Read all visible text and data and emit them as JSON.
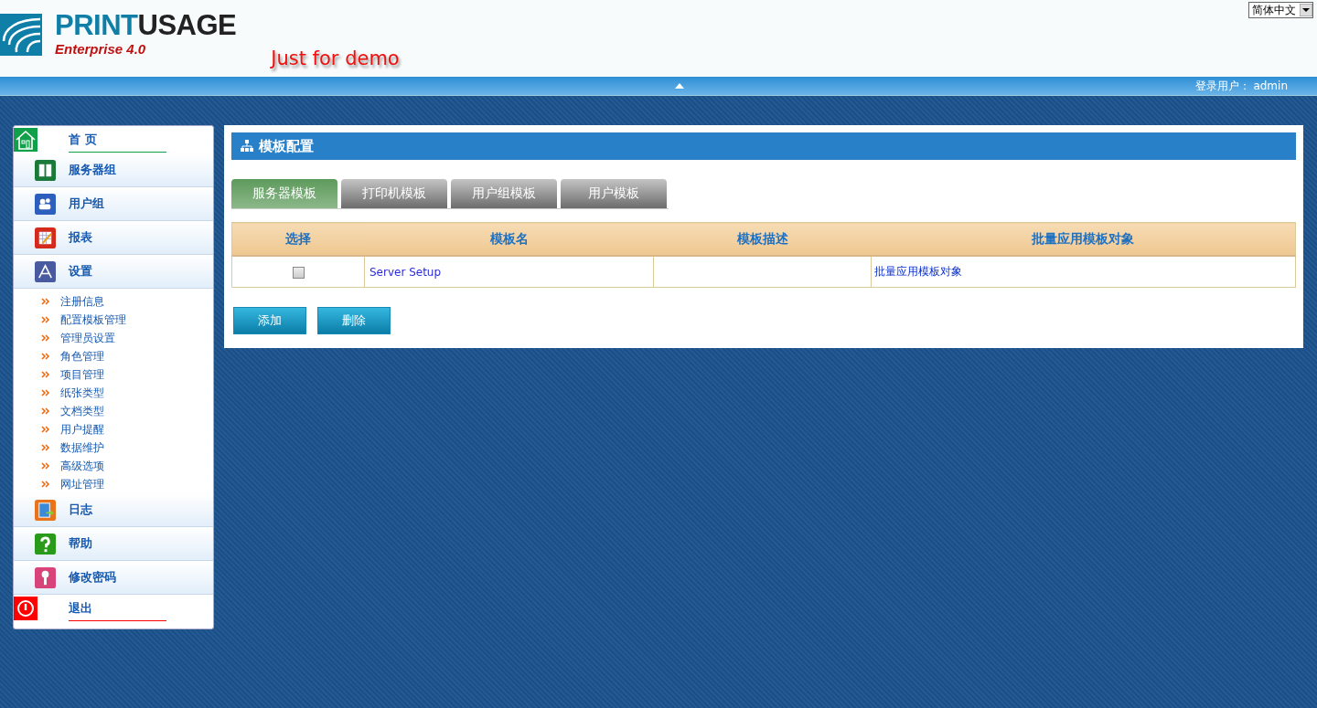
{
  "header": {
    "logo": {
      "name_a": "PRINT",
      "name_b": "USAGE",
      "edition": "Enterprise 4.0"
    },
    "demo_note": "Just for demo",
    "language": "简体中文"
  },
  "top_bar": {
    "user_label": "登录用户：",
    "user": "admin"
  },
  "sidebar": {
    "items": [
      {
        "kind": "home",
        "label": "首 页"
      },
      {
        "kind": "server",
        "label": "服务器组"
      },
      {
        "kind": "users",
        "label": "用户组"
      },
      {
        "kind": "report",
        "label": "报表"
      },
      {
        "kind": "settings",
        "label": "设置",
        "children": [
          {
            "label": "注册信息"
          },
          {
            "label": "配置模板管理"
          },
          {
            "label": "管理员设置"
          },
          {
            "label": "角色管理"
          },
          {
            "label": "项目管理"
          },
          {
            "label": "纸张类型"
          },
          {
            "label": "文档类型"
          },
          {
            "label": "用户提醒"
          },
          {
            "label": "数据维护"
          },
          {
            "label": "高级选项"
          },
          {
            "label": "网址管理"
          }
        ]
      },
      {
        "kind": "log",
        "label": "日志"
      },
      {
        "kind": "help",
        "label": "帮助"
      },
      {
        "kind": "password",
        "label": "修改密码"
      },
      {
        "kind": "exit",
        "label": "退出"
      }
    ]
  },
  "panel": {
    "title": "模板配置",
    "tabs": [
      {
        "label": "服务器模板",
        "selected": true
      },
      {
        "label": "打印机模板",
        "selected": false
      },
      {
        "label": "用户组模板",
        "selected": false
      },
      {
        "label": "用户模板",
        "selected": false
      }
    ],
    "table": {
      "columns": [
        "选择",
        "模板名",
        "模板描述",
        "批量应用模板对象"
      ],
      "rows": [
        {
          "checked": false,
          "name": "Server Setup",
          "action": "批量应用模板对象"
        }
      ]
    },
    "buttons": [
      "添加",
      "删除"
    ]
  }
}
